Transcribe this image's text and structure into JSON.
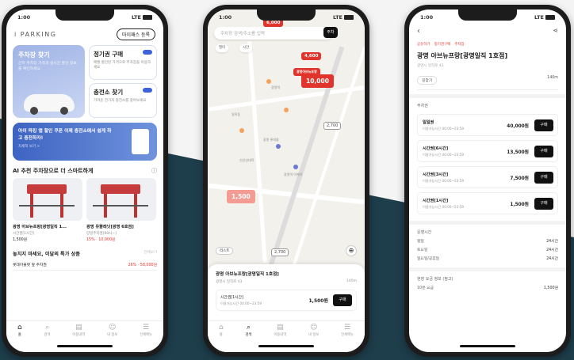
{
  "background": {
    "dark": "#1e3e4c",
    "light": "#f4f4f4"
  },
  "phone1": {
    "status": {
      "time": "1:00",
      "network": "LTE"
    },
    "logo": "i PARKING",
    "my_pass": "마이패스 등록",
    "find_parking": {
      "title": "주차장 찾기",
      "desc": "근처 주차장 가격과 실시간 할인 정보를 확인하세요"
    },
    "season_pass": {
      "title": "정기권 구매",
      "desc": "매월 할인된 가격으로 주차장을 이용하세요"
    },
    "charger": {
      "title": "충전소 찾기",
      "desc": "가까운 전기차 충전소를 찾아보세요"
    },
    "banner": {
      "title": "아이 파킹 앱 할인 쿠폰 이제 충전소에서 쉽게 하고 충전하자!",
      "sub": "자세히 보기 >"
    },
    "ai_section": "AI 추천 주차장으로 더 스마트하게",
    "cards": [
      {
        "name": "광명 아브뉴프랑[광명일직 1...",
        "sub": "시간권[1시간]",
        "price": "1,500원"
      },
      {
        "name": "광명 유플래닛[광명 6호점]",
        "sub": "당일주차권[00시~]",
        "price": "15% · 10,000원"
      }
    ],
    "deal_head": "놓치지 마세요, 이달의 특가 상품",
    "deal_more": "전체보기",
    "deal_row": {
      "name": "롯데아울렛 앞 주차권",
      "price": "26% · 58,000원"
    },
    "tabs": [
      "홈",
      "검색",
      "이용내역",
      "내 정보",
      "전체메뉴"
    ]
  },
  "phone2": {
    "status": {
      "time": "1:00",
      "network": "LTE"
    },
    "search_placeholder": "주차장 검색/주소를 입력",
    "search_btn": "주차",
    "chips": [
      "필터",
      "시간"
    ],
    "pins": [
      "6,000",
      "4,600",
      "10,000",
      "1,500",
      "2,700",
      "2,700"
    ],
    "pin_label": "광명아브뉴프랑",
    "pois": [
      "일직동",
      "광명역",
      "광명 롯데몰",
      "광명역 이케아",
      "신안산대학"
    ],
    "list_btn": "리스트",
    "sheet": {
      "title": "광명 아브뉴프랑[광명일직 1호점]",
      "addr": "광명시 일직로 43",
      "distance": "140m",
      "row": {
        "name": "시간권[1시간]",
        "time": "이용가능시간 00:00~23:59",
        "price": "1,500원",
        "btn": "구매"
      }
    },
    "tabs": [
      "홈",
      "검색",
      "이용내역",
      "내 정보",
      "전체메뉴"
    ]
  },
  "phone3": {
    "status": {
      "time": "1:00",
      "network": "LTE"
    },
    "crumbs": [
      "공유하기",
      "정기권구매",
      "주차장"
    ],
    "title": "광명 아브뉴프랑[광명일직 1호점]",
    "addr": "광명시 일직로 43",
    "tab_label": "길찾기",
    "tab_right": "140m",
    "section_tickets": "주차권",
    "tickets": [
      {
        "name": "일일권",
        "time": "이용가능시간 00:00~23:59",
        "price": "40,000원",
        "btn": "구매"
      },
      {
        "name": "시간권[6시간]",
        "time": "이용가능시간 00:00~23:59",
        "price": "13,500원",
        "btn": "구매"
      },
      {
        "name": "시간권[3시간]",
        "time": "이용가능시간 00:00~23:59",
        "price": "7,500원",
        "btn": "구매"
      },
      {
        "name": "시간권[1시간]",
        "time": "이용가능시간 00:00~23:59",
        "price": "1,500원",
        "btn": "구매"
      }
    ],
    "section_hours": "운영시간",
    "hours": [
      {
        "k": "평일",
        "v": "24시간"
      },
      {
        "k": "토요일",
        "v": "24시간"
      },
      {
        "k": "일요일/공휴일",
        "v": "24시간"
      }
    ],
    "section_fee": "현장 요금 정보 (참고)",
    "fee": {
      "k": "10분 요금",
      "v": "1,500원"
    }
  }
}
